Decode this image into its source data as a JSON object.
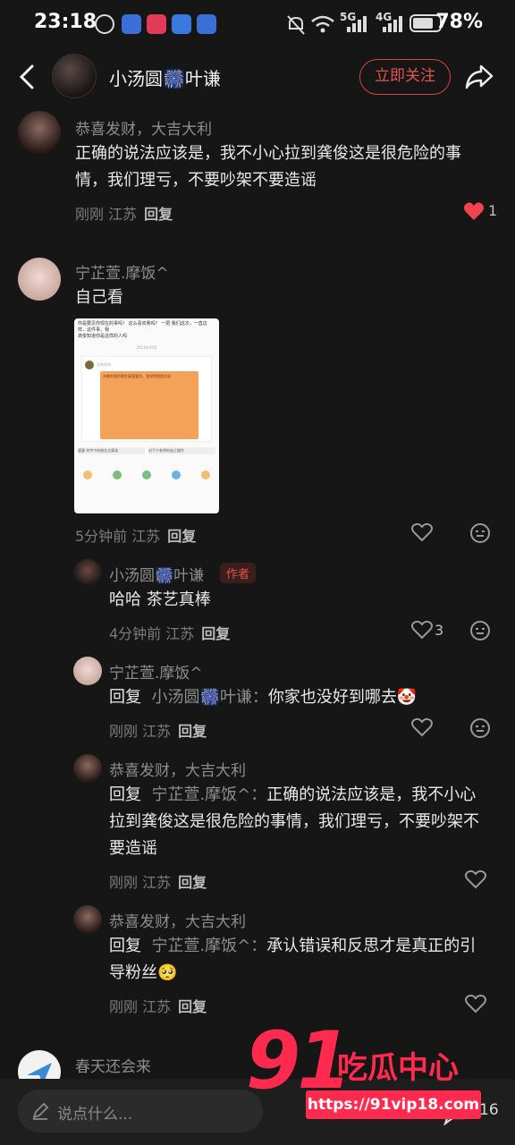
{
  "status_bar": {
    "time": "23:18",
    "battery": "78%",
    "network": "5G",
    "network2": "4G",
    "wifi_tag": "6"
  },
  "header": {
    "username": "小汤圆🎆叶谦",
    "follow_label": "立即关注"
  },
  "comments": [
    {
      "name": "恭喜发财，大吉大利",
      "text_line1": "正确的说法应该是，我不小心拉到龚俊这是很危险的事",
      "text_line2": "情，我们理亏，不要吵架不要造谣",
      "time": "刚刚 江苏",
      "reply": "回复",
      "likes": "1"
    },
    {
      "name": "宁芷萱.摩饭^",
      "text": "自己看",
      "time": "5分钟前 江苏",
      "reply": "回复",
      "screenshot": {
        "header": "你是要见你现在的事吗！ 这么喜欢我吗？ 一把 我们这次，一直这样，这件事，我",
        "header2": "龚俊知道你是这样的人吗",
        "date": "2023年09月",
        "poster": "没有发布",
        "body": "冲着你我的哪些事我爱你，我觉得就是应该",
        "btn1": "滚蛋 刘宇宁的粉丝太搞笑",
        "btn2": "对于宁老师的迷之操作"
      }
    },
    {
      "name": "小汤圆🎆叶谦",
      "author_badge": "作者",
      "text": "哈哈 茶艺真棒",
      "time": "4分钟前 江苏",
      "reply": "回复",
      "likes": "3"
    },
    {
      "name": "宁芷萱.摩饭^",
      "prefix": "回复",
      "target": "小汤圆🎆叶谦：",
      "text": "你家也没好到哪去🤡",
      "time": "刚刚 江苏",
      "reply": "回复"
    },
    {
      "name": "恭喜发财，大吉大利",
      "prefix": "回复",
      "target": "宁芷萱.摩饭^：",
      "text_line1": "正确的说法应该是，我不小心",
      "text_line2": "拉到龚俊这是很危险的事情，我们理亏，不要吵架不",
      "text_line3": "要造谣",
      "time": "刚刚 江苏",
      "reply": "回复"
    },
    {
      "name": "恭喜发财，大吉大利",
      "prefix": "回复",
      "target": "宁芷萱.摩饭^：",
      "text_line1": "承认错误和反思才是真正的引",
      "text_line2": "导粉丝🥺",
      "time": "刚刚 江苏",
      "reply": "回复"
    },
    {
      "name": "春天还会来"
    }
  ],
  "bottom": {
    "placeholder": "说点什么...",
    "comment_count": "16"
  },
  "watermark": {
    "number": "91",
    "title": "吃瓜中心",
    "url": "https://91vip18.com"
  },
  "colors": {
    "accent": "#e5524c",
    "heart_active": "#f0454e",
    "background": "#161616"
  }
}
